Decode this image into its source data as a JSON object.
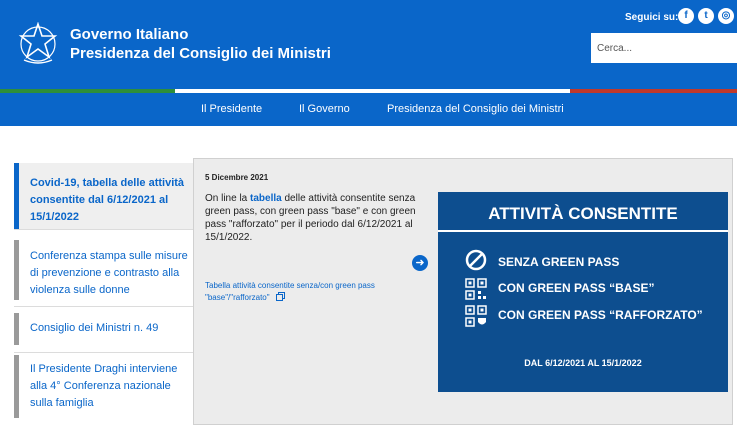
{
  "header": {
    "title": "Governo Italiano",
    "subtitle": "Presidenza del Consiglio dei Ministri",
    "follow_label": "Seguici su:",
    "social": [
      {
        "icon": "facebook-icon",
        "glyph": "f"
      },
      {
        "icon": "twitter-icon",
        "glyph": "t"
      },
      {
        "icon": "instagram-icon",
        "glyph": "◎"
      }
    ],
    "search_placeholder": "Cerca..."
  },
  "nav": {
    "items": [
      "Il Presidente",
      "Il Governo",
      "Presidenza del Consiglio dei Ministri"
    ]
  },
  "sidebar": {
    "items": [
      {
        "label": "Covid-19, tabella delle attività consentite dal 6/12/2021 al 15/1/2022",
        "active": true
      },
      {
        "label": "Conferenza stampa sulle misure di prevenzione e contrasto alla violenza sulle donne",
        "active": false
      },
      {
        "label": "Consiglio dei Ministri n. 49",
        "active": false
      },
      {
        "label": "Il Presidente Draghi interviene alla 4° Conferenza nazionale sulla famiglia",
        "active": false
      }
    ]
  },
  "article": {
    "date": "5 Dicembre 2021",
    "desc_pre": "On line la ",
    "desc_link": "tabella",
    "desc_post": " delle attività consentite senza green pass, con green pass \"base\" e  con green pass \"rafforzato\" per il periodo dal 6/12/2021 al 15/1/2022.",
    "doc_link": "Tabella attività consentite senza/con green pass \"base\"/\"rafforzato\"",
    "doc_icon": "copy-icon"
  },
  "promo": {
    "title": "ATTIVITÀ CONSENTITE",
    "rows": [
      {
        "icon": "no-symbol-icon",
        "label": "SENZA GREEN PASS"
      },
      {
        "icon": "qr-code-icon",
        "label": "CON GREEN PASS “BASE”"
      },
      {
        "icon": "qr-code-shield-icon",
        "label": "CON GREEN PASS “RAFFORZATO”"
      }
    ],
    "date_range": "DAL 6/12/2021 AL 15/1/2022"
  },
  "colors": {
    "primary": "#0a66c9",
    "promo_bg": "#0d4e8f",
    "flag_green": "#2e8f3a",
    "flag_white": "#ffffff",
    "flag_red": "#c0392b"
  }
}
